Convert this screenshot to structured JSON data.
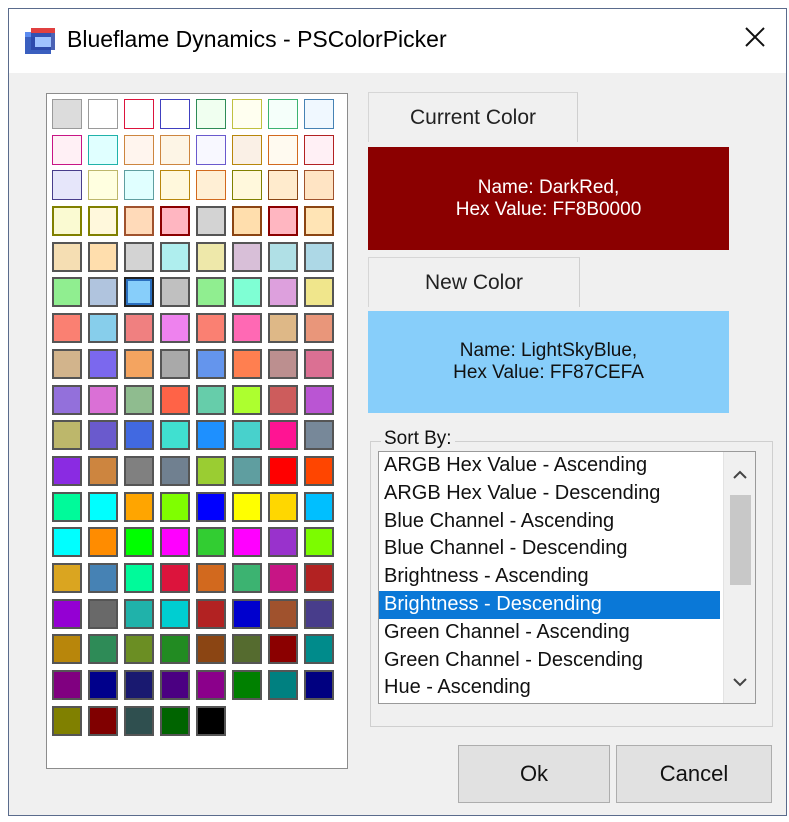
{
  "window": {
    "title": "Blueflame Dynamics - PSColorPicker"
  },
  "icons": {
    "app": "window-app-icon",
    "close": "close-icon",
    "scroll_up": "chevron-up-icon",
    "scroll_down": "chevron-down-icon"
  },
  "current_color": {
    "label": "Current Color",
    "name_line": "Name: DarkRed,",
    "hex_line": "Hex Value: FF8B0000",
    "color": "#8B0000",
    "text_color": "#ffffff"
  },
  "new_color": {
    "label": "New Color",
    "name_line": "Name: LightSkyBlue,",
    "hex_line": "Hex Value: FF87CEFA",
    "color": "#87CEFA",
    "text_color": "#111111"
  },
  "swatches": [
    {
      "fill": "#DCDCDC",
      "border": "#9a9a9a"
    },
    {
      "fill": "#FFFFFF",
      "border": "#9a9a9a"
    },
    {
      "fill": "#FFFFFF",
      "border": "#DC143C"
    },
    {
      "fill": "#FFFFFF",
      "border": "#4040C0"
    },
    {
      "fill": "#F0FFF0",
      "border": "#2E8B57"
    },
    {
      "fill": "#FFFFF0",
      "border": "#C0C040"
    },
    {
      "fill": "#F5FFFA",
      "border": "#3CB371"
    },
    {
      "fill": "#F0F8FF",
      "border": "#4682B4"
    },
    {
      "fill": "#FFF0F5",
      "border": "#C71585"
    },
    {
      "fill": "#E0FFFF",
      "border": "#20B2AA"
    },
    {
      "fill": "#FFF5EE",
      "border": "#CD853F"
    },
    {
      "fill": "#FDF5E6",
      "border": "#CD853F"
    },
    {
      "fill": "#F8F8FF",
      "border": "#6A5ACD"
    },
    {
      "fill": "#FAF0E6",
      "border": "#B8860B"
    },
    {
      "fill": "#FFFAF0",
      "border": "#D2691E"
    },
    {
      "fill": "#FFF0F5",
      "border": "#B22222"
    },
    {
      "fill": "#E6E6FA",
      "border": "#483D8B"
    },
    {
      "fill": "#FFFFE0",
      "border": "#BDB76B"
    },
    {
      "fill": "#E0FFFF",
      "border": "#5F9EA0"
    },
    {
      "fill": "#FFF8DC",
      "border": "#B8860B"
    },
    {
      "fill": "#FFEFD5",
      "border": "#D2691E"
    },
    {
      "fill": "#FFF8DC",
      "border": "#808000"
    },
    {
      "fill": "#FFEBCD",
      "border": "#8B4513"
    },
    {
      "fill": "#FFE4C4",
      "border": "#A0522D"
    },
    {
      "fill": "#FAFAD2",
      "border": "#808000"
    },
    {
      "fill": "#FFF8DC",
      "border": "#808000"
    },
    {
      "fill": "#FFDAB9",
      "border": "#A0522D"
    },
    {
      "fill": "#FFB6C1",
      "border": "#8B0000"
    },
    {
      "fill": "#D3D3D3",
      "border": "#555555"
    },
    {
      "fill": "#FFDEAD",
      "border": "#8B4513"
    },
    {
      "fill": "#FFB6C1",
      "border": "#8B0000"
    },
    {
      "fill": "#FFE4B5",
      "border": "#8B4513"
    },
    {
      "fill": "#F5DEB3",
      "border": "#555555"
    },
    {
      "fill": "#FFDEAD",
      "border": "#555555"
    },
    {
      "fill": "#D3D3D3",
      "border": "#555555"
    },
    {
      "fill": "#AFEEEE",
      "border": "#555555"
    },
    {
      "fill": "#EEE8AA",
      "border": "#555555"
    },
    {
      "fill": "#D8BFD8",
      "border": "#555555"
    },
    {
      "fill": "#B0E0E6",
      "border": "#555555"
    },
    {
      "fill": "#ADD8E6",
      "border": "#555555"
    },
    {
      "fill": "#90EE90",
      "border": "#555555"
    },
    {
      "fill": "#B0C4DE",
      "border": "#555555"
    },
    {
      "fill": "#87CEFA",
      "border": "#222222",
      "selected": true
    },
    {
      "fill": "#C0C0C0",
      "border": "#555555"
    },
    {
      "fill": "#90EE90",
      "border": "#555555"
    },
    {
      "fill": "#7FFFD4",
      "border": "#555555"
    },
    {
      "fill": "#DDA0DD",
      "border": "#555555"
    },
    {
      "fill": "#F0E68C",
      "border": "#555555"
    },
    {
      "fill": "#FA8072",
      "border": "#555555"
    },
    {
      "fill": "#87CEEB",
      "border": "#555555"
    },
    {
      "fill": "#F08080",
      "border": "#555555"
    },
    {
      "fill": "#EE82EE",
      "border": "#555555"
    },
    {
      "fill": "#FA8072",
      "border": "#555555"
    },
    {
      "fill": "#FF69B4",
      "border": "#555555"
    },
    {
      "fill": "#DEB887",
      "border": "#555555"
    },
    {
      "fill": "#E9967A",
      "border": "#555555"
    },
    {
      "fill": "#D2B48C",
      "border": "#555555"
    },
    {
      "fill": "#7B68EE",
      "border": "#555555"
    },
    {
      "fill": "#F4A460",
      "border": "#555555"
    },
    {
      "fill": "#A9A9A9",
      "border": "#555555"
    },
    {
      "fill": "#6495ED",
      "border": "#555555"
    },
    {
      "fill": "#FF7F50",
      "border": "#555555"
    },
    {
      "fill": "#BC8F8F",
      "border": "#555555"
    },
    {
      "fill": "#DB7093",
      "border": "#555555"
    },
    {
      "fill": "#9370DB",
      "border": "#555555"
    },
    {
      "fill": "#DA70D6",
      "border": "#555555"
    },
    {
      "fill": "#8FBC8F",
      "border": "#555555"
    },
    {
      "fill": "#FF6347",
      "border": "#555555"
    },
    {
      "fill": "#66CDAA",
      "border": "#555555"
    },
    {
      "fill": "#ADFF2F",
      "border": "#555555"
    },
    {
      "fill": "#CD5C5C",
      "border": "#555555"
    },
    {
      "fill": "#BA55D3",
      "border": "#555555"
    },
    {
      "fill": "#BDB76B",
      "border": "#555555"
    },
    {
      "fill": "#6A5ACD",
      "border": "#555555"
    },
    {
      "fill": "#4169E1",
      "border": "#555555"
    },
    {
      "fill": "#40E0D0",
      "border": "#555555"
    },
    {
      "fill": "#1E90FF",
      "border": "#555555"
    },
    {
      "fill": "#48D1CC",
      "border": "#555555"
    },
    {
      "fill": "#FF1493",
      "border": "#555555"
    },
    {
      "fill": "#778899",
      "border": "#555555"
    },
    {
      "fill": "#8A2BE2",
      "border": "#555555"
    },
    {
      "fill": "#CD853F",
      "border": "#555555"
    },
    {
      "fill": "#808080",
      "border": "#555555"
    },
    {
      "fill": "#708090",
      "border": "#555555"
    },
    {
      "fill": "#9ACD32",
      "border": "#555555"
    },
    {
      "fill": "#5F9EA0",
      "border": "#555555"
    },
    {
      "fill": "#FF0000",
      "border": "#555555"
    },
    {
      "fill": "#FF4500",
      "border": "#555555"
    },
    {
      "fill": "#00FA9A",
      "border": "#555555"
    },
    {
      "fill": "#00FFFF",
      "border": "#555555"
    },
    {
      "fill": "#FFA500",
      "border": "#555555"
    },
    {
      "fill": "#7FFF00",
      "border": "#555555"
    },
    {
      "fill": "#0000FF",
      "border": "#555555"
    },
    {
      "fill": "#FFFF00",
      "border": "#555555"
    },
    {
      "fill": "#FFD700",
      "border": "#555555"
    },
    {
      "fill": "#00BFFF",
      "border": "#555555"
    },
    {
      "fill": "#00FFFF",
      "border": "#555555"
    },
    {
      "fill": "#FF8C00",
      "border": "#555555"
    },
    {
      "fill": "#00FF00",
      "border": "#555555"
    },
    {
      "fill": "#FF00FF",
      "border": "#555555"
    },
    {
      "fill": "#32CD32",
      "border": "#555555"
    },
    {
      "fill": "#FF00FF",
      "border": "#555555"
    },
    {
      "fill": "#9932CC",
      "border": "#555555"
    },
    {
      "fill": "#7CFC00",
      "border": "#555555"
    },
    {
      "fill": "#DAA520",
      "border": "#555555"
    },
    {
      "fill": "#4682B4",
      "border": "#555555"
    },
    {
      "fill": "#00FA9A",
      "border": "#555555"
    },
    {
      "fill": "#DC143C",
      "border": "#555555"
    },
    {
      "fill": "#D2691E",
      "border": "#555555"
    },
    {
      "fill": "#3CB371",
      "border": "#555555"
    },
    {
      "fill": "#C71585",
      "border": "#555555"
    },
    {
      "fill": "#B22222",
      "border": "#555555"
    },
    {
      "fill": "#9400D3",
      "border": "#555555"
    },
    {
      "fill": "#696969",
      "border": "#555555"
    },
    {
      "fill": "#20B2AA",
      "border": "#555555"
    },
    {
      "fill": "#00CED1",
      "border": "#555555"
    },
    {
      "fill": "#B22222",
      "border": "#555555"
    },
    {
      "fill": "#0000CD",
      "border": "#555555"
    },
    {
      "fill": "#A0522D",
      "border": "#555555"
    },
    {
      "fill": "#483D8B",
      "border": "#555555"
    },
    {
      "fill": "#B8860B",
      "border": "#555555"
    },
    {
      "fill": "#2E8B57",
      "border": "#555555"
    },
    {
      "fill": "#6B8E23",
      "border": "#555555"
    },
    {
      "fill": "#228B22",
      "border": "#555555"
    },
    {
      "fill": "#8B4513",
      "border": "#555555"
    },
    {
      "fill": "#556B2F",
      "border": "#555555"
    },
    {
      "fill": "#8B0000",
      "border": "#555555"
    },
    {
      "fill": "#008B8B",
      "border": "#555555"
    },
    {
      "fill": "#800080",
      "border": "#555555"
    },
    {
      "fill": "#00008B",
      "border": "#555555"
    },
    {
      "fill": "#191970",
      "border": "#555555"
    },
    {
      "fill": "#4B0082",
      "border": "#555555"
    },
    {
      "fill": "#8B008B",
      "border": "#555555"
    },
    {
      "fill": "#008000",
      "border": "#555555"
    },
    {
      "fill": "#008080",
      "border": "#555555"
    },
    {
      "fill": "#000080",
      "border": "#555555"
    },
    {
      "fill": "#808000",
      "border": "#555555"
    },
    {
      "fill": "#800000",
      "border": "#555555"
    },
    {
      "fill": "#2F4F4F",
      "border": "#555555"
    },
    {
      "fill": "#006400",
      "border": "#555555"
    },
    {
      "fill": "#000000",
      "border": "#555555"
    }
  ],
  "sort_by": {
    "label": "Sort By:",
    "items": [
      "ARGB Hex Value - Ascending",
      "ARGB Hex Value - Descending",
      "Blue Channel - Ascending",
      "Blue Channel - Descending",
      "Brightness - Ascending",
      "Brightness - Descending",
      "Green Channel - Ascending",
      "Green Channel - Descending",
      "Hue - Ascending"
    ],
    "selected": "Brightness - Descending",
    "selected_color": "#0A78D7"
  },
  "buttons": {
    "ok": "Ok",
    "cancel": "Cancel"
  }
}
